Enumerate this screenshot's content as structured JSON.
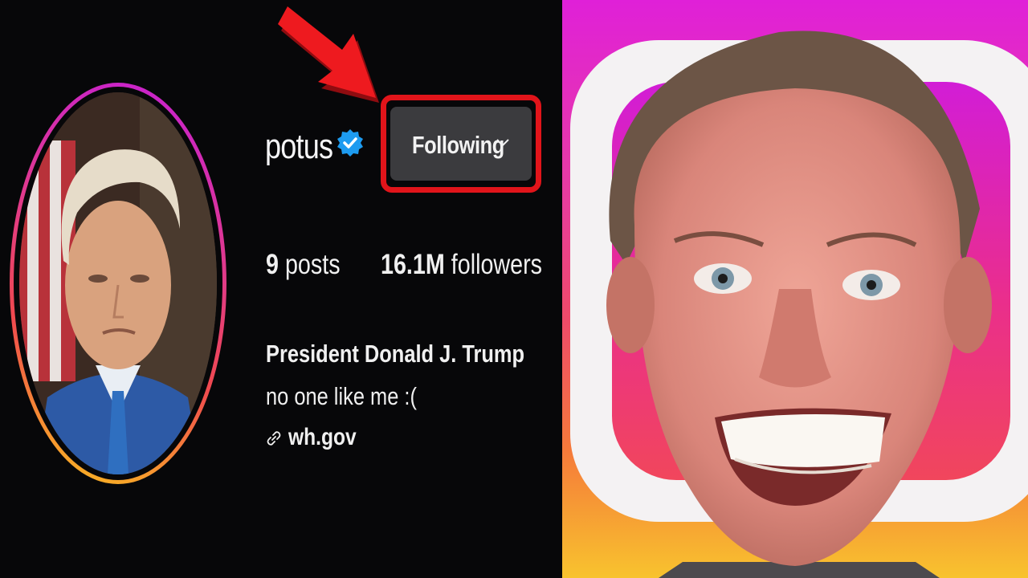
{
  "profile": {
    "username": "potus",
    "full_name": "President Donald J. Trump",
    "bio": "no one like me :(",
    "link": "wh.gov",
    "follow_button_label": "Following",
    "stats": {
      "posts": "9",
      "posts_label": "posts",
      "followers": "16.1M",
      "followers_label": "followers"
    }
  },
  "icons": {
    "verified": "verified-badge-icon",
    "chevron": "chevron-down-icon",
    "link": "link-icon",
    "arrow": "red-arrow-icon",
    "logo": "instagram-logo-icon"
  },
  "colors": {
    "background": "#070709",
    "accent_red": "#e1141a",
    "verified_blue": "#1d9bf0",
    "button_gray": "#3b3b3e"
  }
}
